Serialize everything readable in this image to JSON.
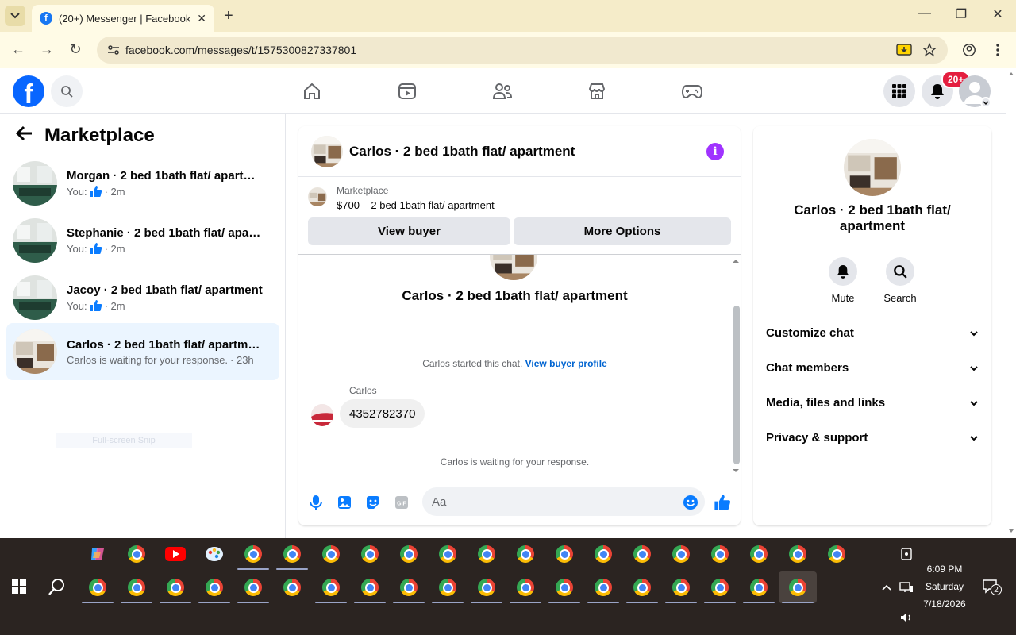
{
  "browser": {
    "tab_title": "(20+) Messenger | Facebook",
    "url": "facebook.com/messages/t/1575300827337801"
  },
  "header": {
    "notification_badge": "20+"
  },
  "sidebar": {
    "title": "Marketplace",
    "conversations": [
      {
        "name": "Morgan · 2 bed 1bath flat/ apartment",
        "prefix": "You:",
        "time": "· 2m",
        "icon": "thumbs-up-icon",
        "active": false
      },
      {
        "name": "Stephanie · 2 bed 1bath flat/ apartment",
        "prefix": "You:",
        "time": "· 2m",
        "icon": "thumbs-up-icon",
        "active": false
      },
      {
        "name": "Jacoy · 2 bed 1bath flat/ apartment",
        "prefix": "You:",
        "time": "· 2m",
        "icon": "thumbs-up-icon",
        "active": false
      },
      {
        "name": "Carlos · 2 bed 1bath flat/ apartment",
        "prefix": "Carlos is waiting for your response.",
        "time": "· 23h",
        "icon": "",
        "active": true
      }
    ],
    "snip_overlay": "Full-screen Snip"
  },
  "chat": {
    "title": "Carlos · 2 bed 1bath flat/ apartment",
    "marketplace_label": "Marketplace",
    "listing": "$700 – 2 bed 1bath flat/ apartment",
    "view_buyer": "View buyer",
    "more_options": "More Options",
    "hero_title": "Carlos · 2 bed 1bath flat/ apartment",
    "started_text": "Carlos started this chat.",
    "view_profile": "View buyer profile",
    "sender": "Carlos",
    "message": "4352782370",
    "waiting": "Carlos is waiting for your response.",
    "composer_placeholder": "Aa"
  },
  "info_panel": {
    "title": "Carlos · 2 bed 1bath flat/ apartment",
    "mute": "Mute",
    "search": "Search",
    "sections": [
      "Customize chat",
      "Chat members",
      "Media, files and links",
      "Privacy & support"
    ]
  },
  "taskbar": {
    "time": "6:09 PM",
    "day": "Saturday",
    "date": "7/18/2026",
    "notif_count": "2"
  },
  "colors": {
    "facebook_blue": "#0866ff",
    "messenger_purple": "#a033ff",
    "link_blue": "#0064d1",
    "badge_red": "#e41e3f"
  }
}
